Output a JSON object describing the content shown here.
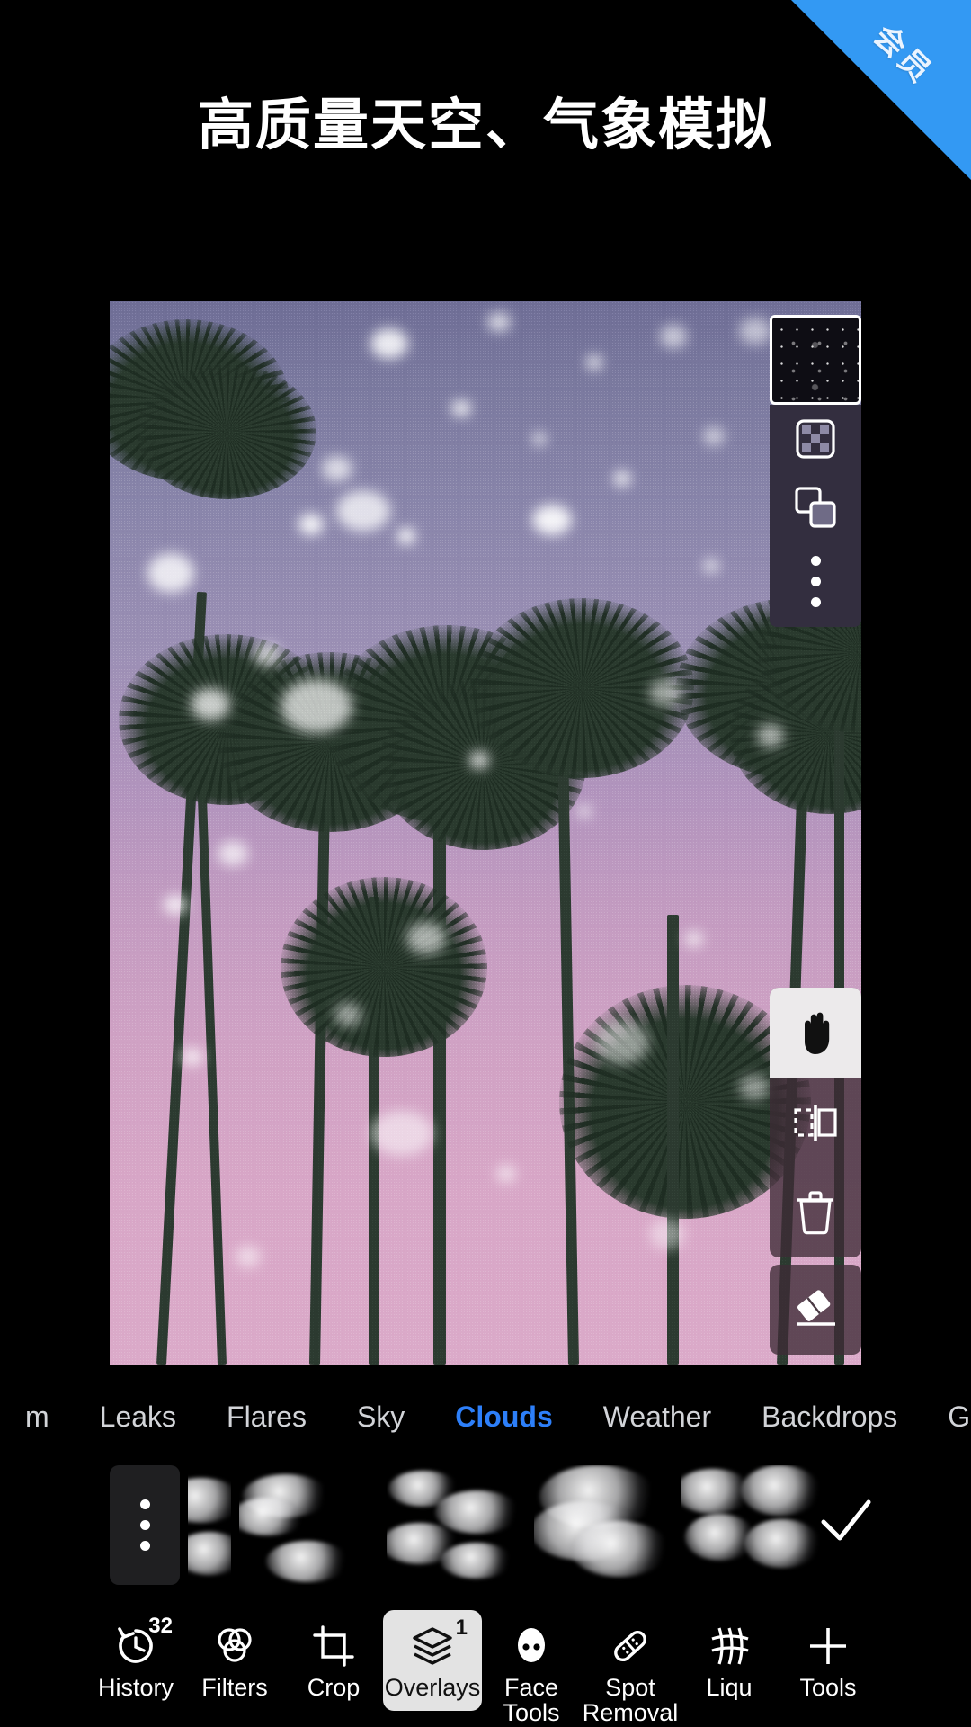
{
  "promo": {
    "ribbon_label": "会员",
    "ribbon_color": "#3399f3"
  },
  "headline": {
    "text": "高质量天空、气象模拟"
  },
  "theme": {
    "accent": "#2d7ff9",
    "background": "#000000",
    "panel": "#332e3f",
    "selected_chip": "#e3e3e3"
  },
  "canvas": {
    "name": "photo-canvas",
    "subject": "palm trees against gradient sky with snow overlay",
    "sky_top_color": "#6f6e96",
    "sky_bottom_color": "#dbaac9"
  },
  "layer_panel": {
    "thumbnail_label": "overlay-layer-thumbnail",
    "buttons": [
      {
        "name": "opacity-icon",
        "label": "Opacity"
      },
      {
        "name": "blend-mode-icon",
        "label": "Blend Mode"
      },
      {
        "name": "more-options-icon",
        "label": "More"
      }
    ]
  },
  "transform_panel": {
    "tools": [
      {
        "name": "move-hand-icon",
        "label": "Move",
        "selected": true
      },
      {
        "name": "flip-icon",
        "label": "Flip",
        "selected": false
      },
      {
        "name": "delete-trash-icon",
        "label": "Delete",
        "selected": false
      }
    ],
    "eraser": {
      "name": "eraser-icon",
      "label": "Erase"
    }
  },
  "category_tabs": {
    "selected": "Clouds",
    "items": [
      {
        "label": "m",
        "active": false,
        "truncated": true
      },
      {
        "label": "Leaks",
        "active": false
      },
      {
        "label": "Flares",
        "active": false
      },
      {
        "label": "Sky",
        "active": false
      },
      {
        "label": "Clouds",
        "active": true
      },
      {
        "label": "Weather",
        "active": false
      },
      {
        "label": "Backdrops",
        "active": false
      },
      {
        "label": "G",
        "active": false,
        "truncated": true
      }
    ]
  },
  "overlay_strip": {
    "more_button": "more-overlays-button",
    "confirm_button": "confirm-checkmark-button",
    "thumbnails": [
      {
        "name": "cloud-thumb-1",
        "partial": true
      },
      {
        "name": "cloud-thumb-2"
      },
      {
        "name": "cloud-thumb-3"
      },
      {
        "name": "cloud-thumb-4"
      },
      {
        "name": "cloud-thumb-5"
      }
    ]
  },
  "toolbar": {
    "items": [
      {
        "label": "History",
        "badge": "32",
        "icon": "history-icon",
        "selected": false
      },
      {
        "label": "Filters",
        "badge": "",
        "icon": "filters-icon",
        "selected": false
      },
      {
        "label": "Crop",
        "badge": "",
        "icon": "crop-icon",
        "selected": false
      },
      {
        "label": "Overlays",
        "badge": "1",
        "icon": "overlays-icon",
        "selected": true
      },
      {
        "label": "Face\nTools",
        "badge": "",
        "icon": "face-tools-icon",
        "selected": false
      },
      {
        "label": "Spot\nRemoval",
        "badge": "",
        "icon": "spot-removal-icon",
        "selected": false
      },
      {
        "label": "Liqu",
        "badge": "",
        "icon": "liquify-icon",
        "selected": false
      },
      {
        "label": "Tools",
        "badge": "",
        "icon": "tools-icon",
        "selected": false
      }
    ]
  }
}
